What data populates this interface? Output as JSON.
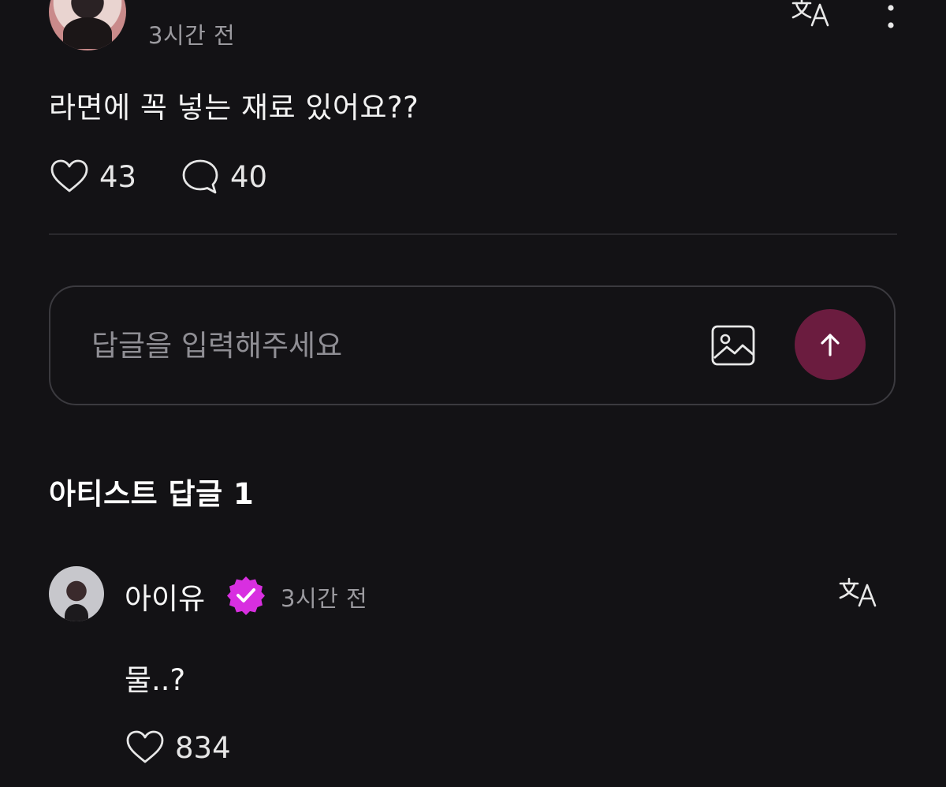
{
  "post": {
    "time": "3시간 전",
    "body": "라면에 꼭 넣는 재료 있어요??",
    "likes": "43",
    "comments": "40"
  },
  "reply_input": {
    "placeholder": "답글을 입력해주세요"
  },
  "artist_replies": {
    "title": "아티스트 답글 1"
  },
  "reply": {
    "author": "아이유",
    "time": "3시간 전",
    "body": "물..?",
    "likes": "834"
  },
  "colors": {
    "background": "#131215",
    "send_button": "#6b1c3f",
    "verified_badge": "#d82fe0"
  },
  "icons": {
    "translate": "translate-icon",
    "more": "more-vertical-icon",
    "like": "heart-icon",
    "comment": "comment-icon",
    "image": "image-icon",
    "send": "arrow-up-icon",
    "verified": "verified-badge-icon"
  }
}
